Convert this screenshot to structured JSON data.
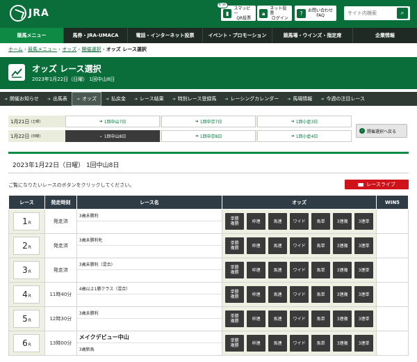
{
  "header": {
    "logo": "JRA",
    "buttons": [
      {
        "badge": "ｾﾞｯﾄ",
        "line1": "スマッピー",
        "line2": "QR投票",
        "icon": "phone-icon"
      },
      {
        "line1": "ネット投票",
        "line2": "ログイン",
        "icon": "lock-icon"
      },
      {
        "line1": "お問い合わせ",
        "line2": "FAQ",
        "icon": "question-icon"
      }
    ],
    "search_placeholder": "サイト内検索"
  },
  "global_nav": [
    "競馬メニュー",
    "馬券・JRA-UMACA",
    "電話・インターネット投票",
    "イベント・プロモーション",
    "競馬場・ウインズ・指定席",
    "企業情報"
  ],
  "breadcrumb": {
    "items": [
      "ホーム",
      "競馬メニュー",
      "オッズ",
      "開催選択"
    ],
    "current": "オッズ レース選択",
    "sep": " › "
  },
  "title": {
    "main": "オッズ レース選択",
    "sub": "2023年1月22日（日曜） 1回中山8日"
  },
  "sub_nav": [
    "開催お知らせ",
    "出馬表",
    "オッズ",
    "払戻金",
    "レース結果",
    "特別レース登録馬",
    "レーシングカレンダー",
    "馬場情報",
    "今週の注目レース"
  ],
  "dates": [
    {
      "label": "1月21日",
      "dow": "(土曜)",
      "venues": [
        "1回中山7日",
        "1回中京7日",
        "1回小倉3日"
      ]
    },
    {
      "label": "1月22日",
      "dow": "(日曜)",
      "venues": [
        "1回中山8日",
        "1回中京8日",
        "1回小倉4日"
      ]
    }
  ],
  "back_button": "開催選択へ戻る",
  "date_heading": "2023年1月22日（日曜） 1回中山8日",
  "instruction": "ご覧になりたいレースのボタンをクリックしてください。",
  "live_button": "レースライブ",
  "table": {
    "headers": [
      "レース",
      "発走時刻",
      "レース名",
      "オッズ",
      "WIN5"
    ],
    "odds_buttons": [
      "単勝\n複勝",
      "枠連",
      "馬連",
      "ワイド",
      "馬単",
      "3連複",
      "3連単"
    ],
    "race_suffix": "R",
    "rows": [
      {
        "no": "1",
        "time": "発走済",
        "name1": "3歳未勝利",
        "name2": ""
      },
      {
        "no": "2",
        "time": "発走済",
        "name1": "3歳未勝利牝",
        "name2": ""
      },
      {
        "no": "3",
        "time": "発走済",
        "name1": "3歳未勝利（混合）",
        "name2": ""
      },
      {
        "no": "4",
        "time": "11時40分",
        "name1": "4歳以上1勝クラス（混合）",
        "name2": ""
      },
      {
        "no": "5",
        "time": "12時30分",
        "name1": "3歳未勝利",
        "name2": ""
      },
      {
        "no": "6",
        "time": "13時00分",
        "name1": "メイクデビュー中山",
        "name2": "3歳新馬"
      }
    ]
  },
  "colors": {
    "brand": "#0a6e3a",
    "live": "#d0121b",
    "odds_button": "#3a3a3a"
  }
}
